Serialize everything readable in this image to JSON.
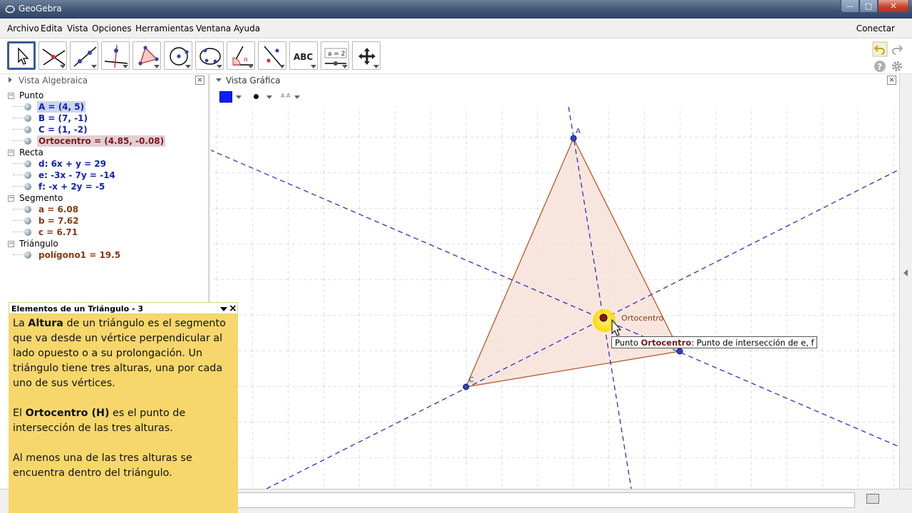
{
  "window": {
    "title": "GeoGebra",
    "buttons": {
      "minimize": "—",
      "maximize": "□",
      "close": "✕"
    }
  },
  "menu": {
    "items": [
      "Archivo",
      "Edita",
      "Vista",
      "Opciones",
      "Herramientas",
      "Ventana",
      "Ayuda"
    ],
    "connect": "Conectar"
  },
  "toolbar": {
    "tools": [
      "move-icon",
      "point-on-line-icon",
      "line-through-points-icon",
      "perpendicular-line-icon",
      "polygon-icon",
      "circle-center-point-icon",
      "conic-icon",
      "angle-icon",
      "reflect-icon",
      "text-icon",
      "slider-icon",
      "move-view-icon"
    ],
    "text_tool_label": "ABC",
    "slider_tool_label": "a = 2"
  },
  "algebra": {
    "title": "Vista Algebraica",
    "categories": [
      {
        "label": "Punto",
        "items": [
          "A = (4, 5)",
          "B = (7, -1)",
          "C = (1, -2)",
          "Ortocentro = (4.85, -0.08)"
        ]
      },
      {
        "label": "Recta",
        "items": [
          "d: 6x + y = 29",
          "e: -3x - 7y = -14",
          "f: -x + 2y = -5"
        ]
      },
      {
        "label": "Segmento",
        "items": [
          "a = 6.08",
          "b = 7.62",
          "c = 6.71"
        ]
      },
      {
        "label": "Triángulo",
        "items": [
          "polígono1 = 19.5"
        ]
      }
    ]
  },
  "graphics": {
    "title": "Vista Gráfica",
    "color_swatch": "#0a1fff",
    "style_font_label": "A A",
    "point_labels": {
      "A": "A",
      "C": "C",
      "H": "Ortocentro"
    },
    "colors": {
      "triangle_fill": "#f7e2d8",
      "triangle_edge": "#b65a2a",
      "altitude": "#2020c8",
      "point": "#1a2bb0",
      "orthocenter": "#8a1414",
      "highlight": "#ffe300"
    }
  },
  "tooltip": {
    "prefix": "Punto ",
    "name": "Ortocentro",
    "suffix": ": Punto de intersección de e, f"
  },
  "note": {
    "title": "Elementos de un Triángulo - 3",
    "p1_a": "La ",
    "p1_b": "Altura",
    "p1_c": " de un triángulo es el segmento que va desde un vértice perpendicular al lado opuesto o a su prolongación. Un triángulo tiene tres alturas, una por cada uno de sus vértices.",
    "p2_a": "El ",
    "p2_b": "Ortocentro (H)",
    "p2_c": " es el punto de intersección de las tres alturas.",
    "p3": "Al menos una de las tres alturas se encuentra dentro del triángulo."
  }
}
